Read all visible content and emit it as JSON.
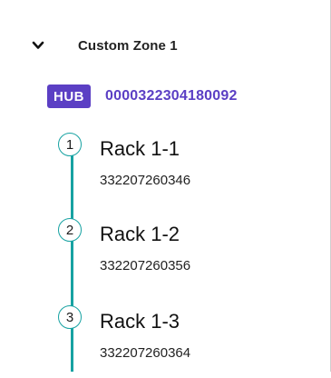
{
  "zone": {
    "title": "Custom Zone 1",
    "expand_icon": "chevron-down-icon"
  },
  "hub": {
    "badge": "HUB",
    "id": "0000322304180092",
    "badge_color": "#5b3fc4",
    "id_color": "#5b3fc4"
  },
  "racks": [
    {
      "number": "1",
      "name": "Rack 1-1",
      "serial": "332207260346"
    },
    {
      "number": "2",
      "name": "Rack 1-2",
      "serial": "332207260356"
    },
    {
      "number": "3",
      "name": "Rack 1-3",
      "serial": "332207260364"
    }
  ],
  "colors": {
    "timeline": "#17a2a2"
  }
}
